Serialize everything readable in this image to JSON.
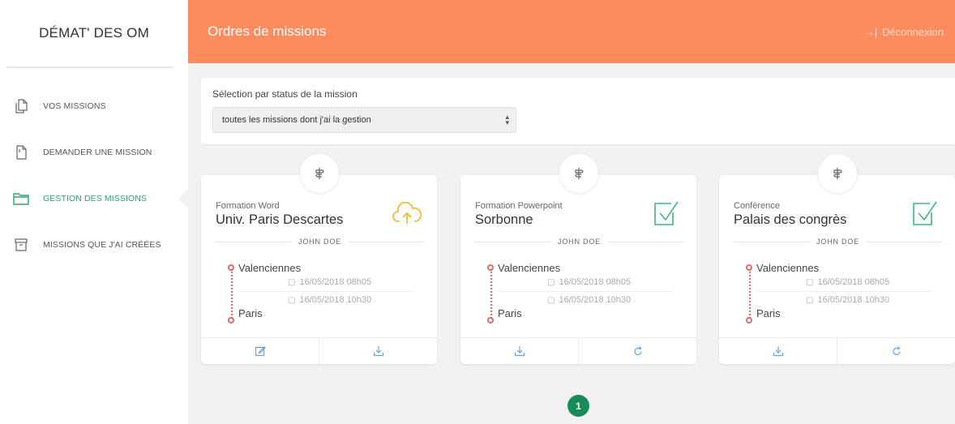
{
  "app": {
    "brand": "DÉMAT' DES OM"
  },
  "sidebar": {
    "items": [
      {
        "label": "VOS MISSIONS",
        "icon": "copy-document-icon",
        "active": false
      },
      {
        "label": "DEMANDER UNE MISSION",
        "icon": "document-icon",
        "active": false
      },
      {
        "label": "GESTION DES MISSIONS",
        "icon": "folder-icon",
        "active": true
      },
      {
        "label": "MISSIONS QUE J'AI CRÉÉES",
        "icon": "archive-icon",
        "active": false
      }
    ]
  },
  "header": {
    "title": "Ordres de missions",
    "logout_label": "Déconnexion",
    "logout_icon": "→|"
  },
  "filter": {
    "label": "Sélection par status de la mission",
    "selected": "toutes les missions dont j'ai la gestion"
  },
  "missions": [
    {
      "subtitle": "Formation Word",
      "title": "Univ. Paris Descartes",
      "person": "JOHN DOE",
      "from": "Valenciennes",
      "date_start": "16/05/2018 08h05",
      "date_end": "16/05/2018 10h30",
      "to": "Paris",
      "status_icon": "cloud-upload-icon",
      "actions": [
        "edit-icon",
        "download-icon"
      ]
    },
    {
      "subtitle": "Formation Powerpoint",
      "title": "Sorbonne",
      "person": "JOHN DOE",
      "from": "Valenciennes",
      "date_start": "16/05/2018 08h05",
      "date_end": "16/05/2018 10h30",
      "to": "Paris",
      "status_icon": "checkbox-checked-icon",
      "actions": [
        "download-icon",
        "refresh-icon"
      ]
    },
    {
      "subtitle": "Conférence",
      "title": "Palais des congrès",
      "person": "JOHN DOE",
      "from": "Valenciennes",
      "date_start": "16/05/2018 08h05",
      "date_end": "16/05/2018 10h30",
      "to": "Paris",
      "status_icon": "checkbox-checked-icon",
      "actions": [
        "download-icon",
        "refresh-icon"
      ]
    }
  ],
  "pagination": {
    "current": "1"
  },
  "colors": {
    "accent": "#ff8c5e",
    "active": "#2ea56b",
    "route": "#e06b6b",
    "pager": "#1a8a57",
    "upload": "#f5b324"
  }
}
